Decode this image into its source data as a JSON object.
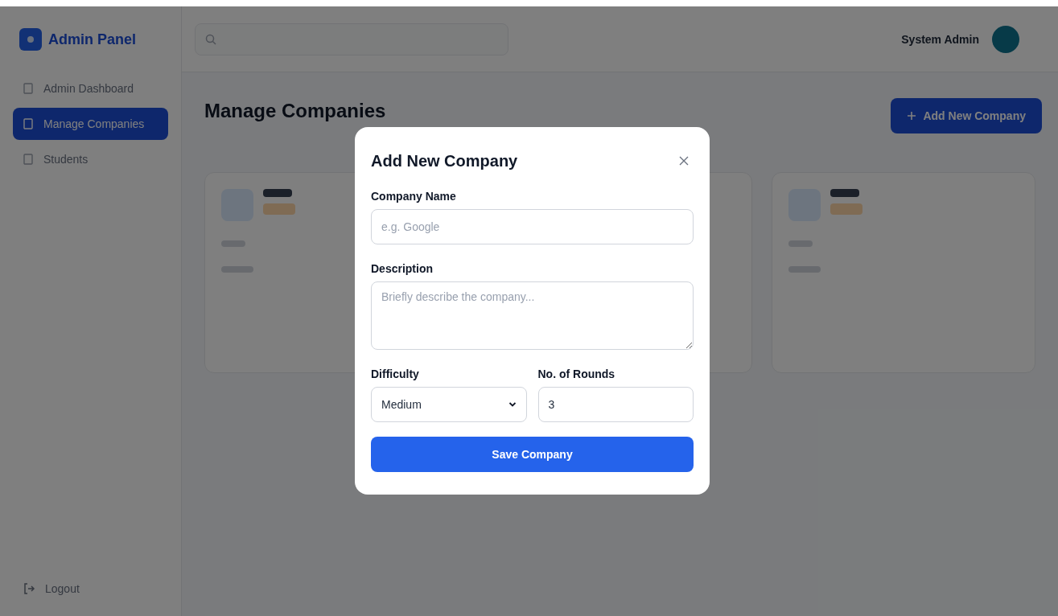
{
  "sidebar": {
    "brand": "Admin Panel",
    "items": [
      {
        "label": "Admin Dashboard",
        "selected": false
      },
      {
        "label": "Manage Companies",
        "selected": true
      },
      {
        "label": "Students",
        "selected": false
      }
    ],
    "logout": "Logout"
  },
  "topbar": {
    "user_name": "System Admin"
  },
  "page": {
    "title": "Manage Companies",
    "add_button": "Add New Company"
  },
  "modal": {
    "title": "Add New Company",
    "fields": [
      {
        "kind": "text",
        "label": "Company Name",
        "placeholder": "e.g. Google"
      },
      {
        "kind": "textarea",
        "label": "Description",
        "placeholder": "Briefly describe the company..."
      }
    ],
    "row": [
      {
        "kind": "select",
        "label": "Difficulty",
        "value": "Medium"
      },
      {
        "kind": "number",
        "label": "No. of Rounds",
        "value": "3"
      }
    ],
    "submit": "Save Company"
  }
}
